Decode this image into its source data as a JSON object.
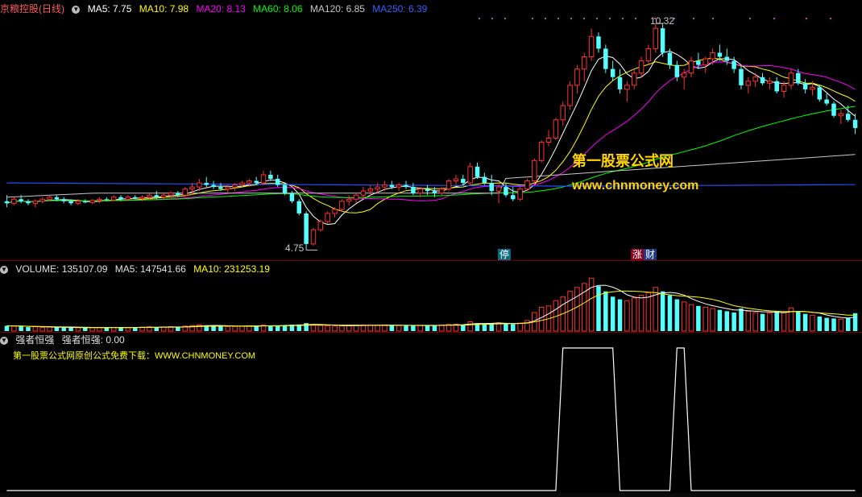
{
  "header": {
    "title": "京粮控股(日线)",
    "ma5_label": "MA5: 7.75",
    "ma10_label": "MA10: 7.98",
    "ma20_label": "MA20: 8.13",
    "ma60_label": "MA60: 8.06",
    "ma120_label": "MA120: 6.85",
    "ma250_label": "MA250: 6.39"
  },
  "price_panel": {
    "high_label": "10.32",
    "low_label": "4.75",
    "tag_stop": "停",
    "tag_zhang": "涨",
    "tag_cai": "财",
    "watermark_cn": "第一股票公式网",
    "watermark_en": "www.chnmoney.com"
  },
  "volume_panel": {
    "label": "VOLUME: 135107.09",
    "ma5_label": "MA5: 147541.66",
    "ma10_label": "MA10: 231253.19"
  },
  "indicator_panel": {
    "name": "强者恒强",
    "value_label": "强者恒强: 0.00",
    "promo": "第一股票公式网原创公式免费下载：WWW.CHNMONEY.COM"
  },
  "colors": {
    "up": "#ff3232",
    "down": "#54ffff",
    "ma5": "#ffffff",
    "ma10": "#ffff00",
    "ma20": "#ff00ff",
    "ma60": "#00ff00",
    "ma120": "#c8c8c8",
    "ma250": "#2050ff",
    "panel_border": "#7a0000"
  },
  "chart_data": {
    "type": "candlestick",
    "price_range": [
      4.6,
      10.5
    ],
    "candles": [
      [
        5.95,
        6.1,
        5.8,
        5.9
      ],
      [
        5.9,
        6.05,
        5.85,
        6.0
      ],
      [
        6.0,
        6.1,
        5.9,
        5.95
      ],
      [
        5.95,
        6.0,
        5.85,
        5.9
      ],
      [
        5.9,
        6.0,
        5.8,
        5.95
      ],
      [
        5.95,
        6.05,
        5.9,
        6.0
      ],
      [
        6.0,
        6.1,
        5.95,
        6.05
      ],
      [
        6.05,
        6.1,
        5.95,
        6.0
      ],
      [
        6.0,
        6.05,
        5.9,
        5.95
      ],
      [
        5.95,
        6.0,
        5.85,
        5.9
      ],
      [
        5.9,
        6.0,
        5.85,
        5.95
      ],
      [
        5.95,
        6.0,
        5.9,
        5.92
      ],
      [
        5.92,
        6.0,
        5.88,
        5.97
      ],
      [
        5.97,
        6.05,
        5.9,
        6.0
      ],
      [
        6.0,
        6.05,
        5.95,
        5.98
      ],
      [
        5.98,
        6.1,
        5.95,
        6.05
      ],
      [
        6.05,
        6.1,
        5.95,
        6.0
      ],
      [
        6.0,
        6.1,
        5.95,
        6.05
      ],
      [
        6.05,
        6.1,
        6.0,
        6.02
      ],
      [
        6.02,
        6.1,
        5.95,
        6.05
      ],
      [
        6.05,
        6.15,
        6.0,
        6.1
      ],
      [
        6.1,
        6.2,
        6.0,
        6.05
      ],
      [
        6.05,
        6.15,
        6.0,
        6.1
      ],
      [
        6.1,
        6.2,
        6.05,
        6.15
      ],
      [
        6.15,
        6.2,
        6.05,
        6.1
      ],
      [
        6.1,
        6.3,
        6.05,
        6.25
      ],
      [
        6.25,
        6.4,
        6.1,
        6.3
      ],
      [
        6.3,
        6.5,
        6.2,
        6.4
      ],
      [
        6.4,
        6.55,
        6.3,
        6.35
      ],
      [
        6.35,
        6.45,
        6.25,
        6.3
      ],
      [
        6.3,
        6.4,
        6.2,
        6.25
      ],
      [
        6.25,
        6.35,
        6.15,
        6.3
      ],
      [
        6.3,
        6.4,
        6.2,
        6.35
      ],
      [
        6.35,
        6.45,
        6.3,
        6.4
      ],
      [
        6.4,
        6.5,
        6.3,
        6.45
      ],
      [
        6.45,
        6.55,
        6.35,
        6.4
      ],
      [
        6.4,
        6.7,
        6.35,
        6.6
      ],
      [
        6.6,
        6.7,
        6.45,
        6.5
      ],
      [
        6.5,
        6.6,
        6.3,
        6.35
      ],
      [
        6.35,
        6.4,
        6.1,
        6.15
      ],
      [
        6.15,
        6.2,
        5.9,
        5.95
      ],
      [
        5.95,
        6.0,
        5.6,
        5.65
      ],
      [
        5.65,
        5.7,
        4.75,
        4.9
      ],
      [
        4.9,
        5.3,
        4.85,
        5.25
      ],
      [
        5.25,
        5.5,
        5.2,
        5.45
      ],
      [
        5.45,
        5.7,
        5.4,
        5.65
      ],
      [
        5.65,
        5.8,
        5.55,
        5.75
      ],
      [
        5.75,
        6.0,
        5.7,
        5.95
      ],
      [
        5.95,
        6.1,
        5.85,
        6.0
      ],
      [
        6.0,
        6.15,
        5.9,
        6.1
      ],
      [
        6.1,
        6.3,
        6.0,
        6.2
      ],
      [
        6.2,
        6.35,
        6.1,
        6.25
      ],
      [
        6.25,
        6.4,
        6.15,
        6.3
      ],
      [
        6.3,
        6.45,
        6.2,
        6.35
      ],
      [
        6.35,
        6.45,
        6.25,
        6.3
      ],
      [
        6.3,
        6.4,
        6.2,
        6.35
      ],
      [
        6.35,
        6.45,
        6.25,
        6.3
      ],
      [
        6.3,
        6.4,
        6.1,
        6.15
      ],
      [
        6.15,
        6.3,
        6.05,
        6.25
      ],
      [
        6.25,
        6.35,
        6.1,
        6.2
      ],
      [
        6.2,
        6.3,
        6.05,
        6.15
      ],
      [
        6.15,
        6.3,
        6.1,
        6.25
      ],
      [
        6.25,
        6.5,
        6.2,
        6.45
      ],
      [
        6.45,
        6.6,
        6.35,
        6.5
      ],
      [
        6.5,
        6.6,
        6.35,
        6.4
      ],
      [
        6.4,
        6.9,
        6.35,
        6.8
      ],
      [
        6.8,
        6.9,
        6.5,
        6.55
      ],
      [
        6.55,
        6.65,
        6.35,
        6.4
      ],
      [
        6.4,
        6.6,
        6.1,
        6.2
      ],
      [
        6.2,
        6.4,
        5.9,
        6.3
      ],
      [
        6.3,
        6.4,
        6.05,
        6.1
      ],
      [
        6.1,
        6.3,
        5.95,
        6.0
      ],
      [
        6.0,
        6.3,
        5.95,
        6.25
      ],
      [
        6.25,
        6.5,
        6.2,
        6.45
      ],
      [
        6.45,
        7.0,
        6.4,
        6.95
      ],
      [
        6.95,
        7.45,
        6.9,
        7.4
      ],
      [
        7.4,
        7.7,
        7.3,
        7.5
      ],
      [
        7.5,
        8.0,
        7.45,
        7.95
      ],
      [
        7.95,
        8.4,
        7.8,
        8.3
      ],
      [
        8.3,
        8.9,
        8.2,
        8.8
      ],
      [
        8.8,
        9.3,
        8.6,
        9.2
      ],
      [
        9.2,
        9.6,
        8.9,
        9.5
      ],
      [
        9.5,
        10.2,
        9.4,
        10.0
      ],
      [
        10.0,
        10.1,
        9.6,
        9.7
      ],
      [
        9.7,
        9.8,
        9.1,
        9.2
      ],
      [
        9.2,
        9.4,
        8.9,
        9.0
      ],
      [
        9.0,
        9.2,
        8.6,
        8.7
      ],
      [
        8.7,
        8.9,
        8.4,
        8.8
      ],
      [
        8.8,
        9.2,
        8.7,
        9.1
      ],
      [
        9.1,
        9.5,
        9.0,
        9.4
      ],
      [
        9.4,
        9.8,
        9.3,
        9.7
      ],
      [
        9.7,
        10.32,
        9.6,
        10.2
      ],
      [
        10.2,
        10.3,
        9.5,
        9.6
      ],
      [
        9.6,
        9.7,
        9.2,
        9.3
      ],
      [
        9.3,
        9.4,
        8.9,
        9.0
      ],
      [
        9.0,
        9.2,
        8.7,
        9.1
      ],
      [
        9.1,
        9.5,
        9.0,
        9.4
      ],
      [
        9.4,
        9.6,
        9.2,
        9.3
      ],
      [
        9.3,
        9.5,
        9.1,
        9.45
      ],
      [
        9.45,
        9.7,
        9.3,
        9.6
      ],
      [
        9.6,
        9.8,
        9.4,
        9.5
      ],
      [
        9.5,
        9.7,
        9.3,
        9.4
      ],
      [
        9.4,
        9.5,
        9.1,
        9.2
      ],
      [
        9.2,
        9.3,
        8.7,
        8.8
      ],
      [
        8.8,
        9.0,
        8.6,
        8.9
      ],
      [
        8.9,
        9.1,
        8.75,
        9.0
      ],
      [
        9.0,
        9.1,
        8.8,
        8.85
      ],
      [
        8.85,
        9.0,
        8.7,
        8.9
      ],
      [
        8.9,
        9.0,
        8.6,
        8.65
      ],
      [
        8.65,
        8.9,
        8.5,
        8.8
      ],
      [
        8.8,
        9.2,
        8.7,
        9.1
      ],
      [
        9.1,
        9.2,
        8.8,
        8.85
      ],
      [
        8.85,
        8.95,
        8.6,
        8.7
      ],
      [
        8.7,
        8.9,
        8.55,
        8.75
      ],
      [
        8.75,
        8.8,
        8.4,
        8.45
      ],
      [
        8.45,
        8.6,
        8.3,
        8.35
      ],
      [
        8.35,
        8.4,
        8.0,
        8.05
      ],
      [
        8.05,
        8.2,
        7.85,
        8.1
      ],
      [
        8.1,
        8.3,
        7.9,
        7.95
      ],
      [
        7.95,
        8.1,
        7.6,
        7.75
      ]
    ],
    "volume_max": 420000,
    "volumes": [
      40000,
      38000,
      35000,
      30000,
      32000,
      28000,
      30000,
      27000,
      26000,
      25000,
      26000,
      25000,
      27000,
      28000,
      26000,
      27000,
      28000,
      26000,
      29000,
      30000,
      32000,
      30000,
      31000,
      33000,
      30000,
      38000,
      42000,
      48000,
      44000,
      40000,
      36000,
      34000,
      35000,
      38000,
      40000,
      37000,
      45000,
      42000,
      40000,
      46000,
      48000,
      50000,
      60000,
      45000,
      42000,
      40000,
      38000,
      40000,
      42000,
      44000,
      46000,
      44000,
      45000,
      46000,
      44000,
      42000,
      40000,
      41000,
      43000,
      42000,
      44000,
      45000,
      50000,
      52000,
      48000,
      70000,
      60000,
      55000,
      58000,
      62000,
      56000,
      52000,
      60000,
      80000,
      140000,
      180000,
      190000,
      230000,
      260000,
      300000,
      330000,
      360000,
      400000,
      340000,
      300000,
      260000,
      240000,
      230000,
      250000,
      270000,
      290000,
      330000,
      300000,
      270000,
      240000,
      220000,
      200000,
      190000,
      180000,
      170000,
      160000,
      150000,
      140000,
      170000,
      150000,
      140000,
      130000,
      135000,
      150000,
      140000,
      175000,
      145000,
      130000,
      120000,
      110000,
      100000,
      95000,
      90000,
      100000,
      135107
    ],
    "indicator_segments": [
      [
        78,
        81
      ],
      [
        82,
        85
      ],
      [
        94,
        95
      ]
    ],
    "ma_last_values": {
      "MA5": 7.75,
      "MA10": 7.98,
      "MA20": 8.13,
      "MA60": 8.06,
      "MA120": 6.85,
      "MA250": 6.39
    }
  }
}
